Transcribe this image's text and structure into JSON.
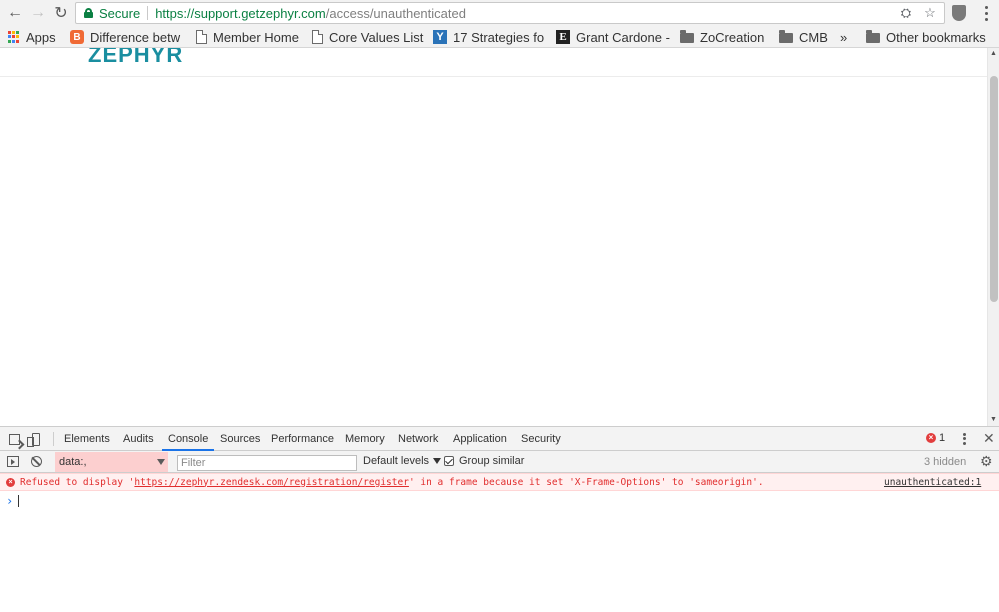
{
  "browser": {
    "secure_label": "Secure",
    "url_host": "https://support.getzephyr.com",
    "url_path": "/access/unauthenticated"
  },
  "bookmarks": [
    {
      "label": "Apps",
      "icon": "apps-grid-icon"
    },
    {
      "label": "Difference betw",
      "icon": "blogger-icon"
    },
    {
      "label": "Member Home",
      "icon": "page-icon"
    },
    {
      "label": "Core Values List",
      "icon": "page-icon"
    },
    {
      "label": "17 Strategies fo",
      "icon": "y-icon"
    },
    {
      "label": "Grant Cardone -",
      "icon": "e-icon"
    },
    {
      "label": "ZoCreation",
      "icon": "folder-icon"
    },
    {
      "label": "CMB",
      "icon": "folder-icon"
    },
    {
      "label": "»",
      "icon": "chevron-double-icon"
    },
    {
      "label": "Other bookmarks",
      "icon": "folder-icon"
    }
  ],
  "page": {
    "logo_text": "ZEPHYR"
  },
  "devtools": {
    "tabs": [
      "Elements",
      "Audits",
      "Console",
      "Sources",
      "Performance",
      "Memory",
      "Network",
      "Application",
      "Security"
    ],
    "active_tab": "Console",
    "error_count": "1",
    "context_value": "data:,",
    "filter_placeholder": "Filter",
    "levels_label": "Default levels",
    "group_similar_label": "Group similar",
    "hidden_count": "3 hidden",
    "error_message": {
      "prefix": "Refused to display '",
      "link": "https://zephyr.zendesk.com/registration/register",
      "suffix": "' in a frame because it set 'X-Frame-Options' to 'sameorigin'.",
      "source": "unauthenticated:1"
    },
    "prompt_symbol": "›"
  },
  "colors": {
    "secure_green": "#0b8043",
    "logo_teal": "#1a8ea0",
    "error_red": "#e12d2d",
    "active_tab_blue": "#1a73e8"
  }
}
